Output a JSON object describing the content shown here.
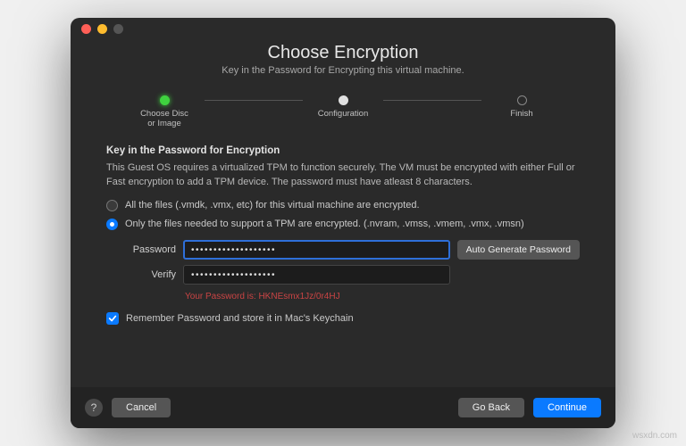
{
  "header": {
    "title": "Choose Encryption",
    "subtitle": "Key in the Password for Encrypting this virtual machine."
  },
  "stepper": {
    "step1": "Choose Disc\nor Image",
    "step2": "Configuration",
    "step3": "Finish"
  },
  "content": {
    "section_head": "Key in the Password for Encryption",
    "description": "This Guest OS requires a virtualized TPM to function securely. The VM must be encrypted with either Full or Fast encryption to add a TPM device. The password must have atleast 8 characters.",
    "option_full": "All the files (.vmdk, .vmx, etc) for this virtual machine are encrypted.",
    "option_fast": "Only the files needed to support a TPM are encrypted. (.nvram, .vmss, .vmem, .vmx, .vmsn)"
  },
  "form": {
    "password_label": "Password",
    "verify_label": "Verify",
    "password_dots": "•••••••••••••••••••",
    "verify_dots": "•••••••••••••••••••",
    "autogen_label": "Auto Generate Password",
    "reveal_prefix": "Your Password is: ",
    "reveal_value": "HKNEsmx1Jz/0r4HJ",
    "remember_label": "Remember Password and store it in Mac's Keychain"
  },
  "footer": {
    "help": "?",
    "cancel": "Cancel",
    "back": "Go Back",
    "continue": "Continue"
  },
  "watermark": "wsxdn.com"
}
